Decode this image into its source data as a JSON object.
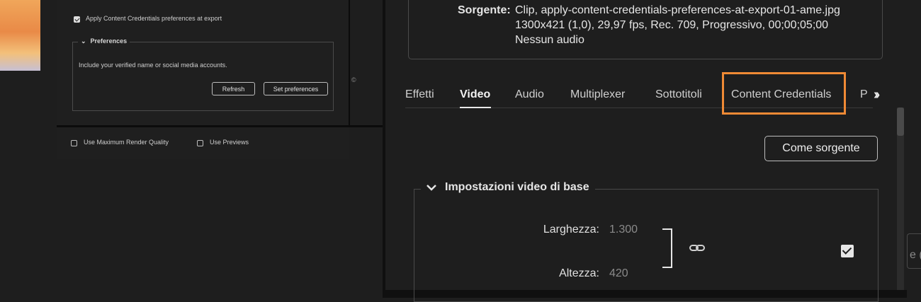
{
  "left_panel": {
    "apply_checkbox_label": "Apply Content Credentials preferences at export",
    "preferences_legend": "Preferences",
    "preferences_description": "Include your verified name or social media accounts.",
    "refresh_button": "Refresh",
    "set_preferences_button": "Set preferences",
    "max_render_quality_label": "Use Maximum Render Quality",
    "use_previews_label": "Use Previews",
    "apply_checked": true
  },
  "source": {
    "label": "Sorgente:",
    "line1": "Clip, apply-content-credentials-preferences-at-export-01-ame.jpg",
    "line2": "1300x421 (1,0), 29,97 fps, Rec. 709, Progressivo, 00;00;05;00",
    "line3": "Nessun audio"
  },
  "tabs": [
    {
      "label": "Effetti"
    },
    {
      "label": "Video",
      "active": true
    },
    {
      "label": "Audio"
    },
    {
      "label": "Multiplexer"
    },
    {
      "label": "Sottotitoli"
    },
    {
      "label": "Content Credentials",
      "highlighted": true
    },
    {
      "label": "P"
    }
  ],
  "match_source_button": "Come sorgente",
  "basic_video": {
    "legend": "Impostazioni video di base",
    "width_label": "Larghezza:",
    "width_value": "1.300",
    "height_label": "Altezza:",
    "height_value": "420",
    "linked": true
  },
  "edge_text": "e (C",
  "edge_glyph": "©",
  "colors": {
    "highlight": "#f08a35",
    "background": "#1e1e1e"
  }
}
